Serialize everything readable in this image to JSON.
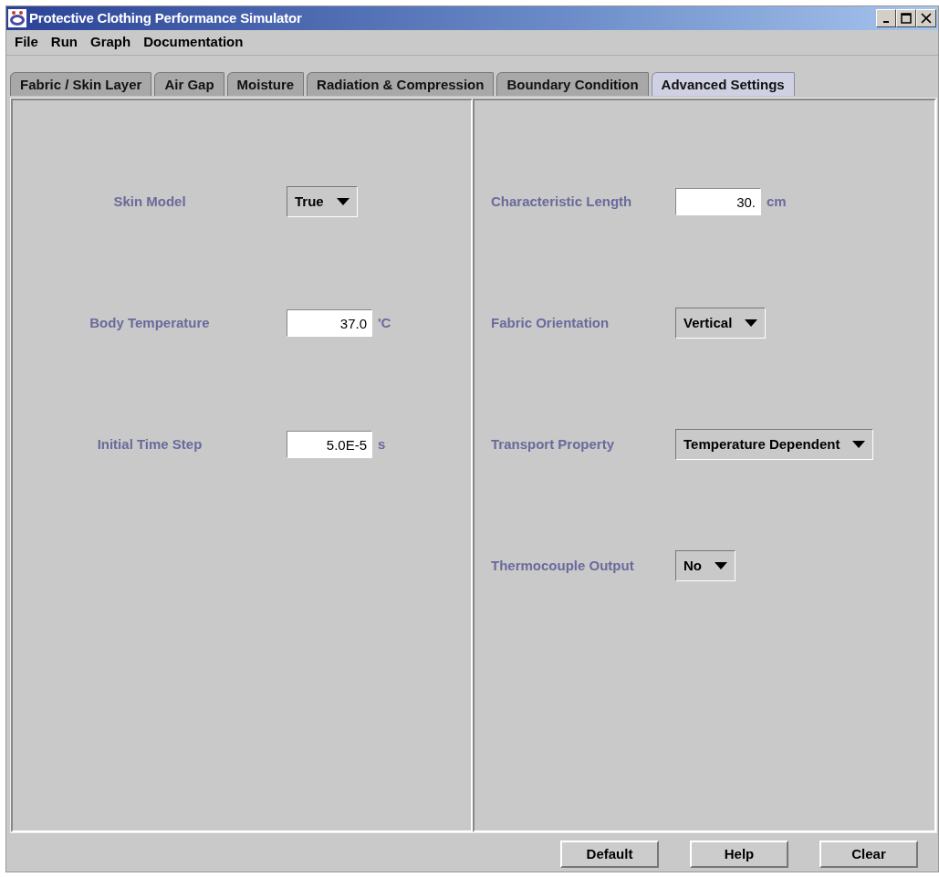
{
  "window": {
    "title": "Protective Clothing Performance Simulator"
  },
  "menu": [
    "File",
    "Run",
    "Graph",
    "Documentation"
  ],
  "tabs": [
    {
      "label": "Fabric / Skin Layer",
      "selected": false
    },
    {
      "label": "Air Gap",
      "selected": false
    },
    {
      "label": "Moisture",
      "selected": false
    },
    {
      "label": "Radiation & Compression",
      "selected": false
    },
    {
      "label": "Boundary Condition",
      "selected": false
    },
    {
      "label": "Advanced Settings",
      "selected": true
    }
  ],
  "left_panel": [
    {
      "label": "Skin Model",
      "kind": "dropdown",
      "value": "True"
    },
    {
      "label": "Body Temperature",
      "kind": "text",
      "value": "37.0",
      "unit": "'C"
    },
    {
      "label": "Initial Time Step",
      "kind": "text",
      "value": "5.0E-5",
      "unit": "s"
    }
  ],
  "right_panel": [
    {
      "label": "Characteristic Length",
      "kind": "text",
      "value": "30.",
      "unit": "cm"
    },
    {
      "label": "Fabric Orientation",
      "kind": "dropdown",
      "value": "Vertical"
    },
    {
      "label": "Transport Property",
      "kind": "dropdown",
      "value": "Temperature Dependent"
    },
    {
      "label": "Thermocouple Output",
      "kind": "dropdown",
      "value": "No"
    }
  ],
  "buttons": [
    "Default",
    "Help",
    "Clear"
  ]
}
